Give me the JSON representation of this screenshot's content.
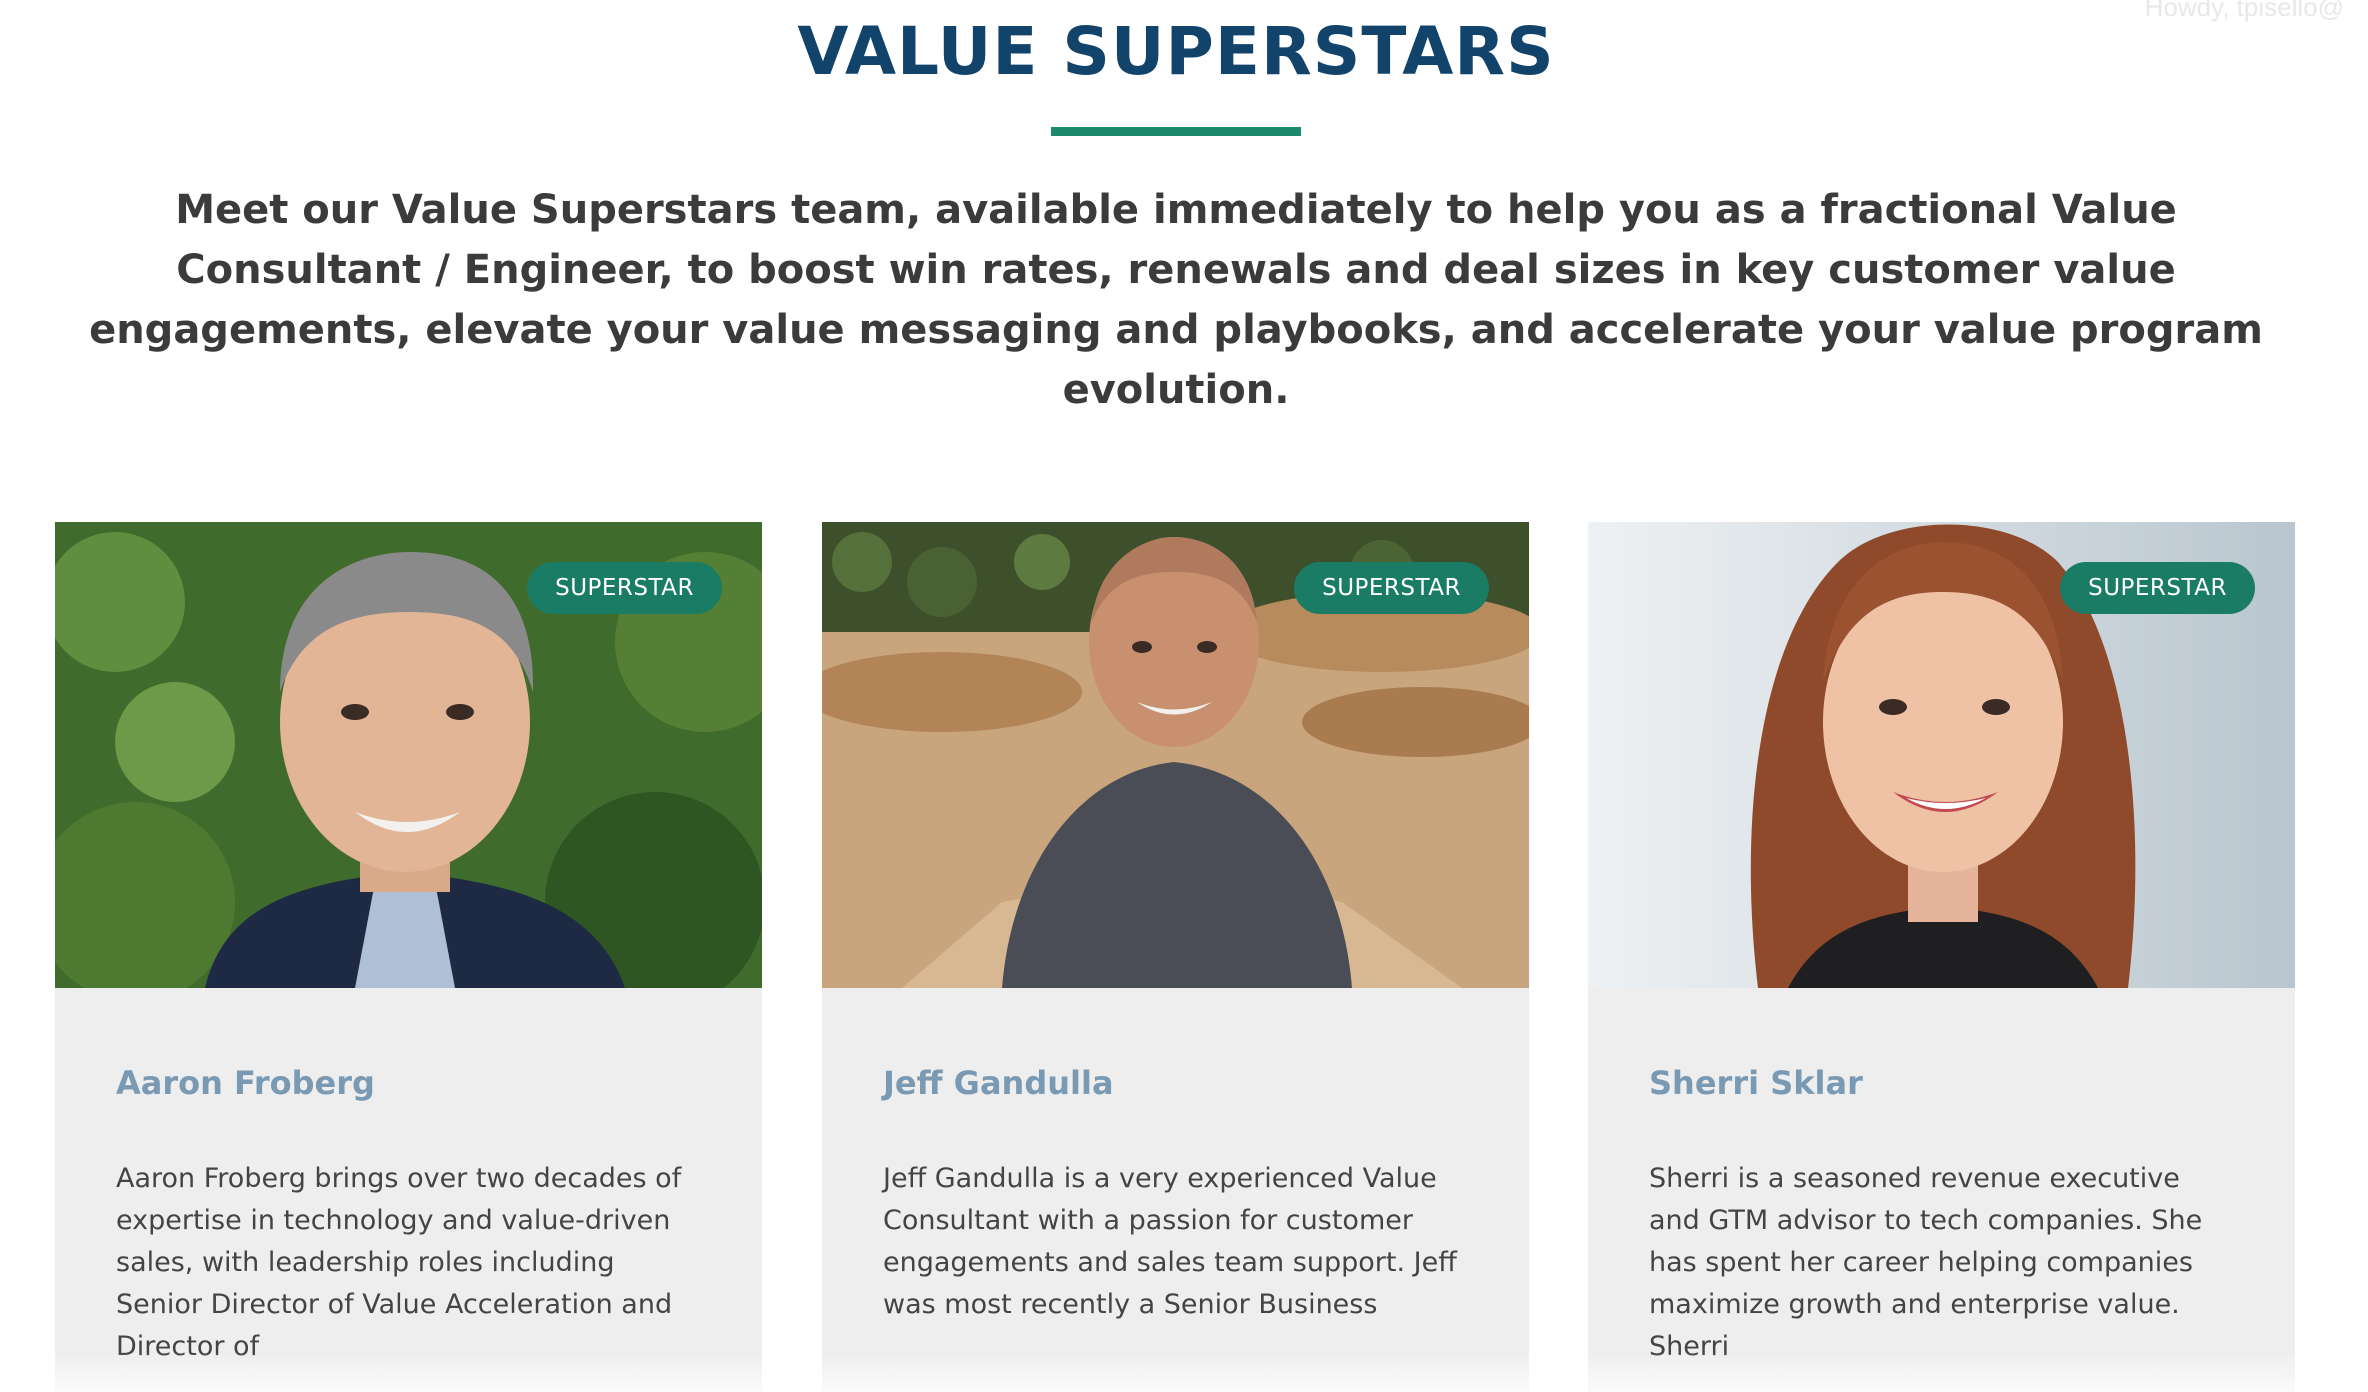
{
  "header": {
    "howdy": "Howdy, tpisello@"
  },
  "section": {
    "title": "VALUE SUPERSTARS",
    "intro": "Meet our Value Superstars team, available immediately to help you as a fractional Value Consultant / Engineer, to boost win rates, renewals and deal sizes in key customer value engagements, elevate your value messaging and playbooks, and accelerate your value program evolution."
  },
  "colors": {
    "title": "#12436b",
    "accent_rule": "#1b8a6b",
    "badge": "#1a7c64",
    "name": "#7a9ab4",
    "card_bg": "#eeeeee"
  },
  "cards": [
    {
      "badge": "SUPERSTAR",
      "name": "Aaron Froberg",
      "bio": "Aaron Froberg brings over two decades of expertise in technology and value-driven sales, with leadership roles including Senior Director of Value Acceleration and Director of",
      "photo_icon": "portrait-photo"
    },
    {
      "badge": "SUPERSTAR",
      "name": "Jeff Gandulla",
      "bio": "Jeff Gandulla is a very experienced Value Consultant with a passion for customer engagements and sales team support. Jeff was most recently a Senior Business",
      "photo_icon": "portrait-photo"
    },
    {
      "badge": "SUPERSTAR",
      "name": "Sherri Sklar",
      "bio": "Sherri is a seasoned revenue executive and GTM advisor to tech companies. She has spent her career helping companies maximize growth and enterprise value. Sherri",
      "photo_icon": "portrait-photo"
    }
  ]
}
